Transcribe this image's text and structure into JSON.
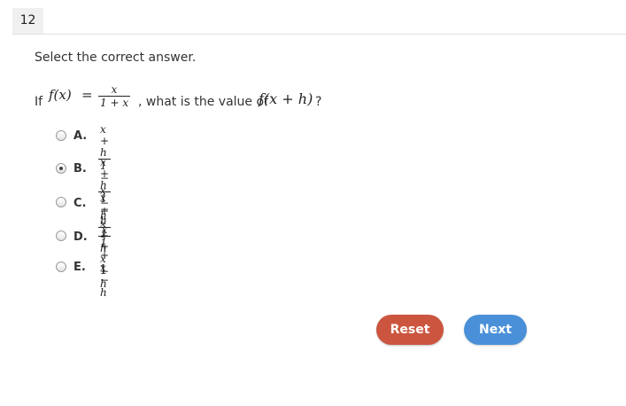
{
  "question_number": "12",
  "instruction": "Select the correct answer.",
  "question": {
    "prefix": "If",
    "lhs": "f(x)",
    "equals": "=",
    "rhs_num": "x",
    "rhs_den": "1 + x",
    "middle": ", what is the value of",
    "target": "f(x + h)",
    "suffix": "?"
  },
  "options": [
    {
      "letter": "A.",
      "num": "x + h",
      "den": "1 − x − h",
      "selected": false
    },
    {
      "letter": "B.",
      "num": "x + h",
      "den": "1 + x + h",
      "selected": true
    },
    {
      "letter": "C.",
      "num": "x − h",
      "den": "1 + x − h",
      "selected": false
    },
    {
      "letter": "D.",
      "num": "x",
      "den": "1 + x − h",
      "selected": false
    },
    {
      "letter": "E.",
      "value": "1",
      "selected": false
    }
  ],
  "buttons": {
    "reset": "Reset",
    "next": "Next"
  },
  "colors": {
    "reset": "#cb553f",
    "next": "#4a90d8"
  }
}
